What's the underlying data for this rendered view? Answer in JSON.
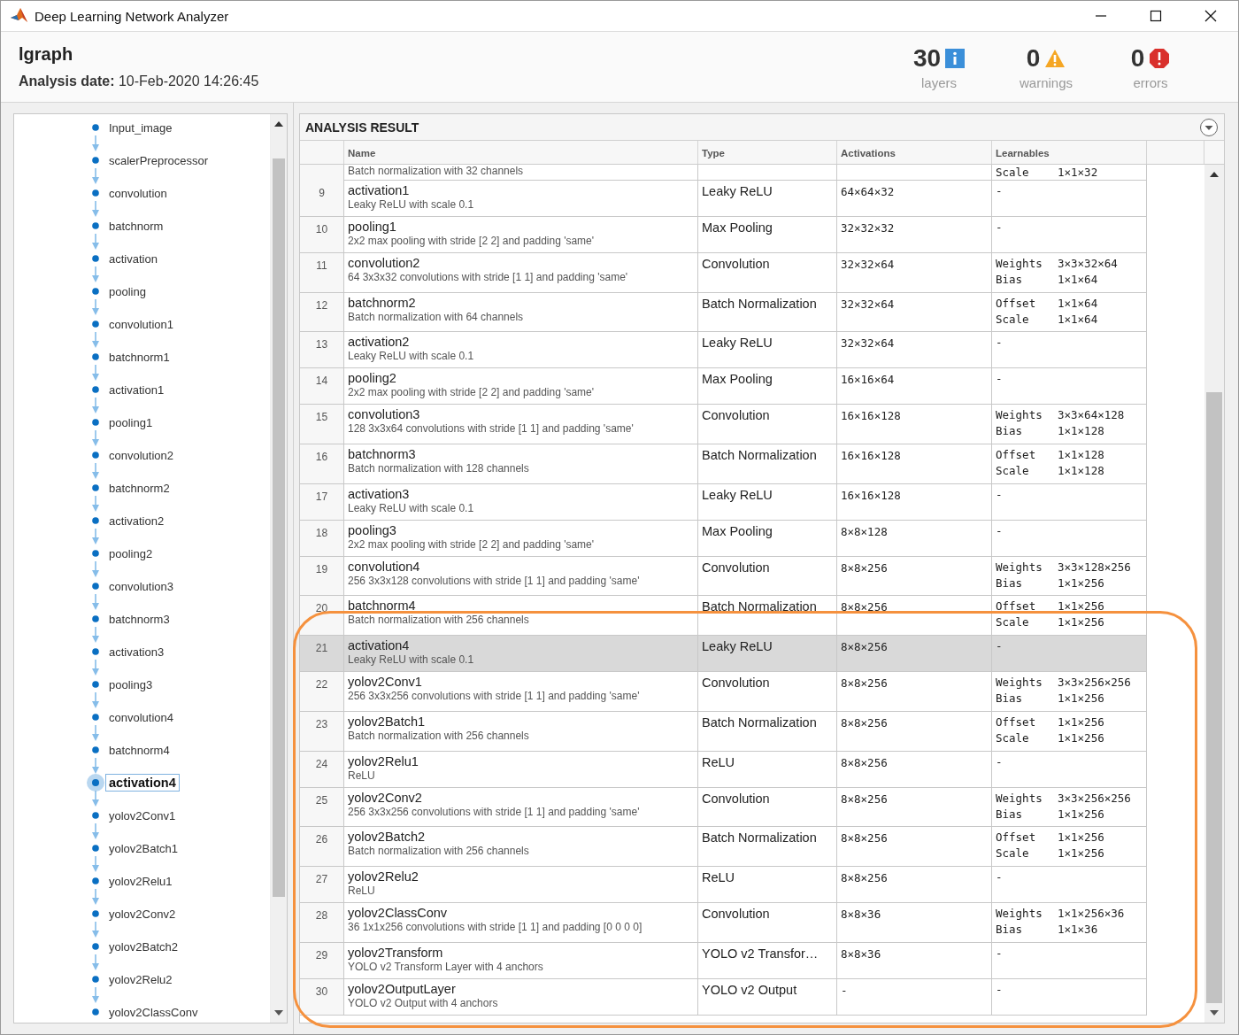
{
  "window": {
    "title": "Deep Learning Network Analyzer"
  },
  "header": {
    "network": "lgraph",
    "analysis_date": "**Analysis date:** 10-Feb-2020 14:26:45",
    "stats": [
      {
        "count": "30",
        "kind": "info",
        "label": "layers"
      },
      {
        "count": "0",
        "kind": "warning",
        "label": "warnings"
      },
      {
        "count": "0",
        "kind": "error",
        "label": "errors"
      }
    ]
  },
  "layer_graph": [
    {
      "label": "Input_image",
      "selected": false
    },
    {
      "label": "scalerPreprocessor",
      "selected": false
    },
    {
      "label": "convolution",
      "selected": false
    },
    {
      "label": "batchnorm",
      "selected": false
    },
    {
      "label": "activation",
      "selected": false
    },
    {
      "label": "pooling",
      "selected": false
    },
    {
      "label": "convolution1",
      "selected": false
    },
    {
      "label": "batchnorm1",
      "selected": false
    },
    {
      "label": "activation1",
      "selected": false
    },
    {
      "label": "pooling1",
      "selected": false
    },
    {
      "label": "convolution2",
      "selected": false
    },
    {
      "label": "batchnorm2",
      "selected": false
    },
    {
      "label": "activation2",
      "selected": false
    },
    {
      "label": "pooling2",
      "selected": false
    },
    {
      "label": "convolution3",
      "selected": false
    },
    {
      "label": "batchnorm3",
      "selected": false
    },
    {
      "label": "activation3",
      "selected": false
    },
    {
      "label": "pooling3",
      "selected": false
    },
    {
      "label": "convolution4",
      "selected": false
    },
    {
      "label": "batchnorm4",
      "selected": false
    },
    {
      "label": "activation4",
      "selected": true
    },
    {
      "label": "yolov2Conv1",
      "selected": false
    },
    {
      "label": "yolov2Batch1",
      "selected": false
    },
    {
      "label": "yolov2Relu1",
      "selected": false
    },
    {
      "label": "yolov2Conv2",
      "selected": false
    },
    {
      "label": "yolov2Batch2",
      "selected": false
    },
    {
      "label": "yolov2Relu2",
      "selected": false
    },
    {
      "label": "yolov2ClassConv",
      "selected": false
    }
  ],
  "analysis_result": {
    "title": "ANALYSIS RESULT",
    "columns": [
      "Name",
      "Type",
      "Activations",
      "Learnables"
    ],
    "rows": [
      {
        "kind": "partial",
        "description": "Batch normalization with 32 channels",
        "learnables": [
          {
            "name": "Scale",
            "size": "1×1×32"
          }
        ]
      },
      {
        "kind": "full",
        "number": "9",
        "name": "activation1",
        "description": "Leaky ReLU with scale 0.1",
        "type": "Leaky ReLU",
        "activations": "64×64×32",
        "learnables": "-",
        "selected": false
      },
      {
        "kind": "full",
        "number": "10",
        "name": "pooling1",
        "description": "2x2 max pooling with stride [2 2] and padding 'same'",
        "type": "Max Pooling",
        "activations": "32×32×32",
        "learnables": "-",
        "selected": false
      },
      {
        "kind": "full",
        "number": "11",
        "name": "convolution2",
        "description": "64 3x3x32 convolutions with stride [1 1] and padding 'same'",
        "type": "Convolution",
        "activations": "32×32×64",
        "learnables": [
          {
            "name": "Weights",
            "size": "3×3×32×64"
          },
          {
            "name": "Bias",
            "size": "1×1×64"
          }
        ],
        "selected": false
      },
      {
        "kind": "full",
        "number": "12",
        "name": "batchnorm2",
        "description": "Batch normalization with 64 channels",
        "type": "Batch Normalization",
        "activations": "32×32×64",
        "learnables": [
          {
            "name": "Offset",
            "size": "1×1×64"
          },
          {
            "name": "Scale",
            "size": "1×1×64"
          }
        ],
        "selected": false
      },
      {
        "kind": "full",
        "number": "13",
        "name": "activation2",
        "description": "Leaky ReLU with scale 0.1",
        "type": "Leaky ReLU",
        "activations": "32×32×64",
        "learnables": "-",
        "selected": false
      },
      {
        "kind": "full",
        "number": "14",
        "name": "pooling2",
        "description": "2x2 max pooling with stride [2 2] and padding 'same'",
        "type": "Max Pooling",
        "activations": "16×16×64",
        "learnables": "-",
        "selected": false
      },
      {
        "kind": "full",
        "number": "15",
        "name": "convolution3",
        "description": "128 3x3x64 convolutions with stride [1 1] and padding 'same'",
        "type": "Convolution",
        "activations": "16×16×128",
        "learnables": [
          {
            "name": "Weights",
            "size": "3×3×64×128"
          },
          {
            "name": "Bias",
            "size": "1×1×128"
          }
        ],
        "selected": false
      },
      {
        "kind": "full",
        "number": "16",
        "name": "batchnorm3",
        "description": "Batch normalization with 128 channels",
        "type": "Batch Normalization",
        "activations": "16×16×128",
        "learnables": [
          {
            "name": "Offset",
            "size": "1×1×128"
          },
          {
            "name": "Scale",
            "size": "1×1×128"
          }
        ],
        "selected": false
      },
      {
        "kind": "full",
        "number": "17",
        "name": "activation3",
        "description": "Leaky ReLU with scale 0.1",
        "type": "Leaky ReLU",
        "activations": "16×16×128",
        "learnables": "-",
        "selected": false
      },
      {
        "kind": "full",
        "number": "18",
        "name": "pooling3",
        "description": "2x2 max pooling with stride [2 2] and padding 'same'",
        "type": "Max Pooling",
        "activations": "8×8×128",
        "learnables": "-",
        "selected": false
      },
      {
        "kind": "full",
        "number": "19",
        "name": "convolution4",
        "description": "256 3x3x128 convolutions with stride [1 1] and padding 'same'",
        "type": "Convolution",
        "activations": "8×8×256",
        "learnables": [
          {
            "name": "Weights",
            "size": "3×3×128×256"
          },
          {
            "name": "Bias",
            "size": "1×1×256"
          }
        ],
        "selected": false
      },
      {
        "kind": "full",
        "number": "20",
        "name": "batchnorm4",
        "description": "Batch normalization with 256 channels",
        "type": "Batch Normalization",
        "activations": "8×8×256",
        "learnables": [
          {
            "name": "Offset",
            "size": "1×1×256"
          },
          {
            "name": "Scale",
            "size": "1×1×256"
          }
        ],
        "selected": false
      },
      {
        "kind": "full",
        "number": "21",
        "name": "activation4",
        "description": "Leaky ReLU with scale 0.1",
        "type": "Leaky ReLU",
        "activations": "8×8×256",
        "learnables": "-",
        "selected": true
      },
      {
        "kind": "full",
        "number": "22",
        "name": "yolov2Conv1",
        "description": "256 3x3x256 convolutions with stride [1 1] and padding 'same'",
        "type": "Convolution",
        "activations": "8×8×256",
        "learnables": [
          {
            "name": "Weights",
            "size": "3×3×256×256"
          },
          {
            "name": "Bias",
            "size": "1×1×256"
          }
        ],
        "selected": false
      },
      {
        "kind": "full",
        "number": "23",
        "name": "yolov2Batch1",
        "description": "Batch normalization with 256 channels",
        "type": "Batch Normalization",
        "activations": "8×8×256",
        "learnables": [
          {
            "name": "Offset",
            "size": "1×1×256"
          },
          {
            "name": "Scale",
            "size": "1×1×256"
          }
        ],
        "selected": false
      },
      {
        "kind": "full",
        "number": "24",
        "name": "yolov2Relu1",
        "description": "ReLU",
        "type": "ReLU",
        "activations": "8×8×256",
        "learnables": "-",
        "selected": false
      },
      {
        "kind": "full",
        "number": "25",
        "name": "yolov2Conv2",
        "description": "256 3x3x256 convolutions with stride [1 1] and padding 'same'",
        "type": "Convolution",
        "activations": "8×8×256",
        "learnables": [
          {
            "name": "Weights",
            "size": "3×3×256×256"
          },
          {
            "name": "Bias",
            "size": "1×1×256"
          }
        ],
        "selected": false
      },
      {
        "kind": "full",
        "number": "26",
        "name": "yolov2Batch2",
        "description": "Batch normalization with 256 channels",
        "type": "Batch Normalization",
        "activations": "8×8×256",
        "learnables": [
          {
            "name": "Offset",
            "size": "1×1×256"
          },
          {
            "name": "Scale",
            "size": "1×1×256"
          }
        ],
        "selected": false
      },
      {
        "kind": "full",
        "number": "27",
        "name": "yolov2Relu2",
        "description": "ReLU",
        "type": "ReLU",
        "activations": "8×8×256",
        "learnables": "-",
        "selected": false
      },
      {
        "kind": "full",
        "number": "28",
        "name": "yolov2ClassConv",
        "description": "36 1x1x256 convolutions with stride [1 1] and padding [0 0 0 0]",
        "type": "Convolution",
        "activations": "8×8×36",
        "learnables": [
          {
            "name": "Weights",
            "size": "1×1×256×36"
          },
          {
            "name": "Bias",
            "size": "1×1×36"
          }
        ],
        "selected": false
      },
      {
        "kind": "full",
        "number": "29",
        "name": "yolov2Transform",
        "description": "YOLO v2 Transform Layer with 4 anchors",
        "type": "YOLO v2 Transfor…",
        "activations": "8×8×36",
        "learnables": "-",
        "selected": false
      },
      {
        "kind": "full",
        "number": "30",
        "name": "yolov2OutputLayer",
        "description": "YOLO v2 Output with 4 anchors",
        "type": "YOLO v2 Output",
        "activations": "-",
        "learnables": "-",
        "selected": false
      }
    ]
  }
}
